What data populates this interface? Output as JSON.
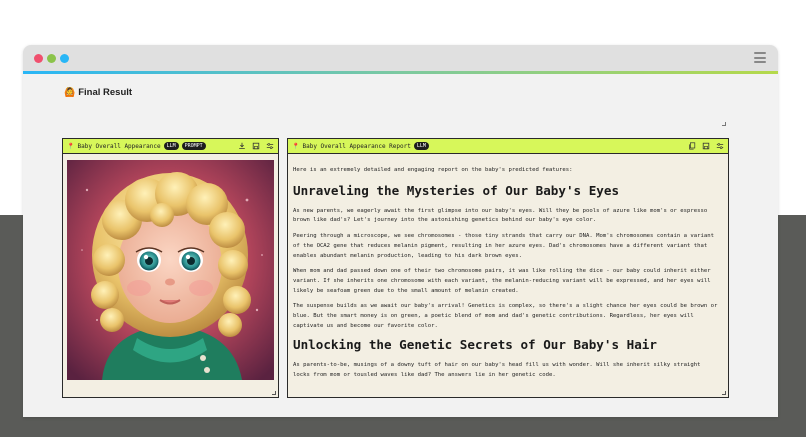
{
  "page": {
    "title_emoji": "🙆",
    "title": "Final Result"
  },
  "left_panel": {
    "title": "Baby Overall Appearance",
    "badges": [
      "LLM",
      "PROMPT"
    ],
    "image_alt": "Illustration of a baby with blonde curly hair and blue eyes wearing a green outfit"
  },
  "right_panel": {
    "title": "Baby Overall Appearance Report",
    "badges": [
      "LLM"
    ],
    "intro": "Here is an extremely detailed and engaging report on the baby's predicted features:",
    "heading1": "Unraveling the Mysteries of Our Baby's Eyes",
    "p1": "As new parents, we eagerly await the first glimpse into our baby's eyes. Will they be pools of azure like mom's or espresso brown like dad's? Let's journey into the astonishing genetics behind our baby's eye color.",
    "p2": "Peering through a microscope, we see chromosomes - those tiny strands that carry our DNA. Mom's chromosomes contain a variant of the OCA2 gene that reduces melanin pigment, resulting in her azure eyes. Dad's chromosomes have a different variant that enables abundant melanin production, leading to his dark brown eyes.",
    "p3": "When mom and dad passed down one of their two chromosome pairs, it was like rolling the dice - our baby could inherit either variant. If she inherits one chromosome with each variant, the melanin-reducing variant will be expressed, and her eyes will likely be seafoam green due to the small amount of melanin created.",
    "p4": "The suspense builds as we await our baby's arrival! Genetics is complex, so there's a slight chance her eyes could be brown or blue. But the smart money is on green, a poetic blend of mom and dad's genetic contributions. Regardless, her eyes will captivate us and become our favorite color.",
    "heading2": "Unlocking the Genetic Secrets of Our Baby's Hair",
    "p5": "As parents-to-be, musings of a downy tuft of hair on our baby's head fill us with wonder. Will she inherit silky straight locks from mom or tousled waves like dad? The answers lie in her genetic code."
  },
  "colors": {
    "accent_header": "#d7f75a",
    "panel_bg": "#f3efe3",
    "badge_bg": "#1d1d1d",
    "backdrop": "#5a5b58"
  },
  "icons": {
    "left_panel": [
      "download-icon",
      "save-icon",
      "settings-sliders-icon"
    ],
    "right_panel": [
      "copy-icon",
      "save-icon",
      "settings-sliders-icon"
    ],
    "window": [
      "hamburger-menu-icon"
    ]
  }
}
